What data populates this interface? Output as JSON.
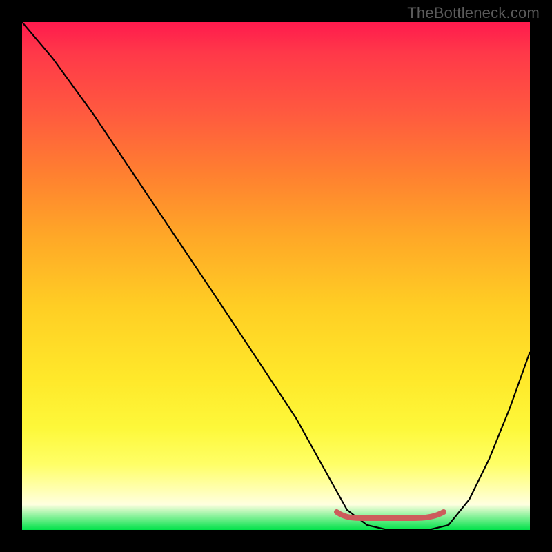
{
  "watermark": "TheBottleneck.com",
  "chart_data": {
    "type": "line",
    "title": "",
    "xlabel": "",
    "ylabel": "",
    "xlim": [
      0,
      100
    ],
    "ylim": [
      0,
      100
    ],
    "series": [
      {
        "name": "curve",
        "x": [
          0,
          6,
          14,
          22,
          30,
          38,
          46,
          54,
          60,
          64,
          68,
          72,
          76,
          80,
          84,
          88,
          92,
          96,
          100
        ],
        "y": [
          100,
          93,
          82,
          70,
          58,
          46,
          34,
          22,
          11,
          4,
          1,
          0,
          0,
          0,
          1,
          6,
          14,
          24,
          35
        ]
      },
      {
        "name": "floor_hump",
        "x": [
          62,
          65,
          68,
          71,
          74,
          77,
          80,
          83
        ],
        "y": [
          3.5,
          2.5,
          2.5,
          2.5,
          2.5,
          2.5,
          2.5,
          3.5
        ]
      }
    ],
    "colors": {
      "curve": "#000000",
      "floor_hump": "#cd5c5c",
      "gradient_top": "#ff1a4d",
      "gradient_bottom": "#00e24a"
    }
  }
}
